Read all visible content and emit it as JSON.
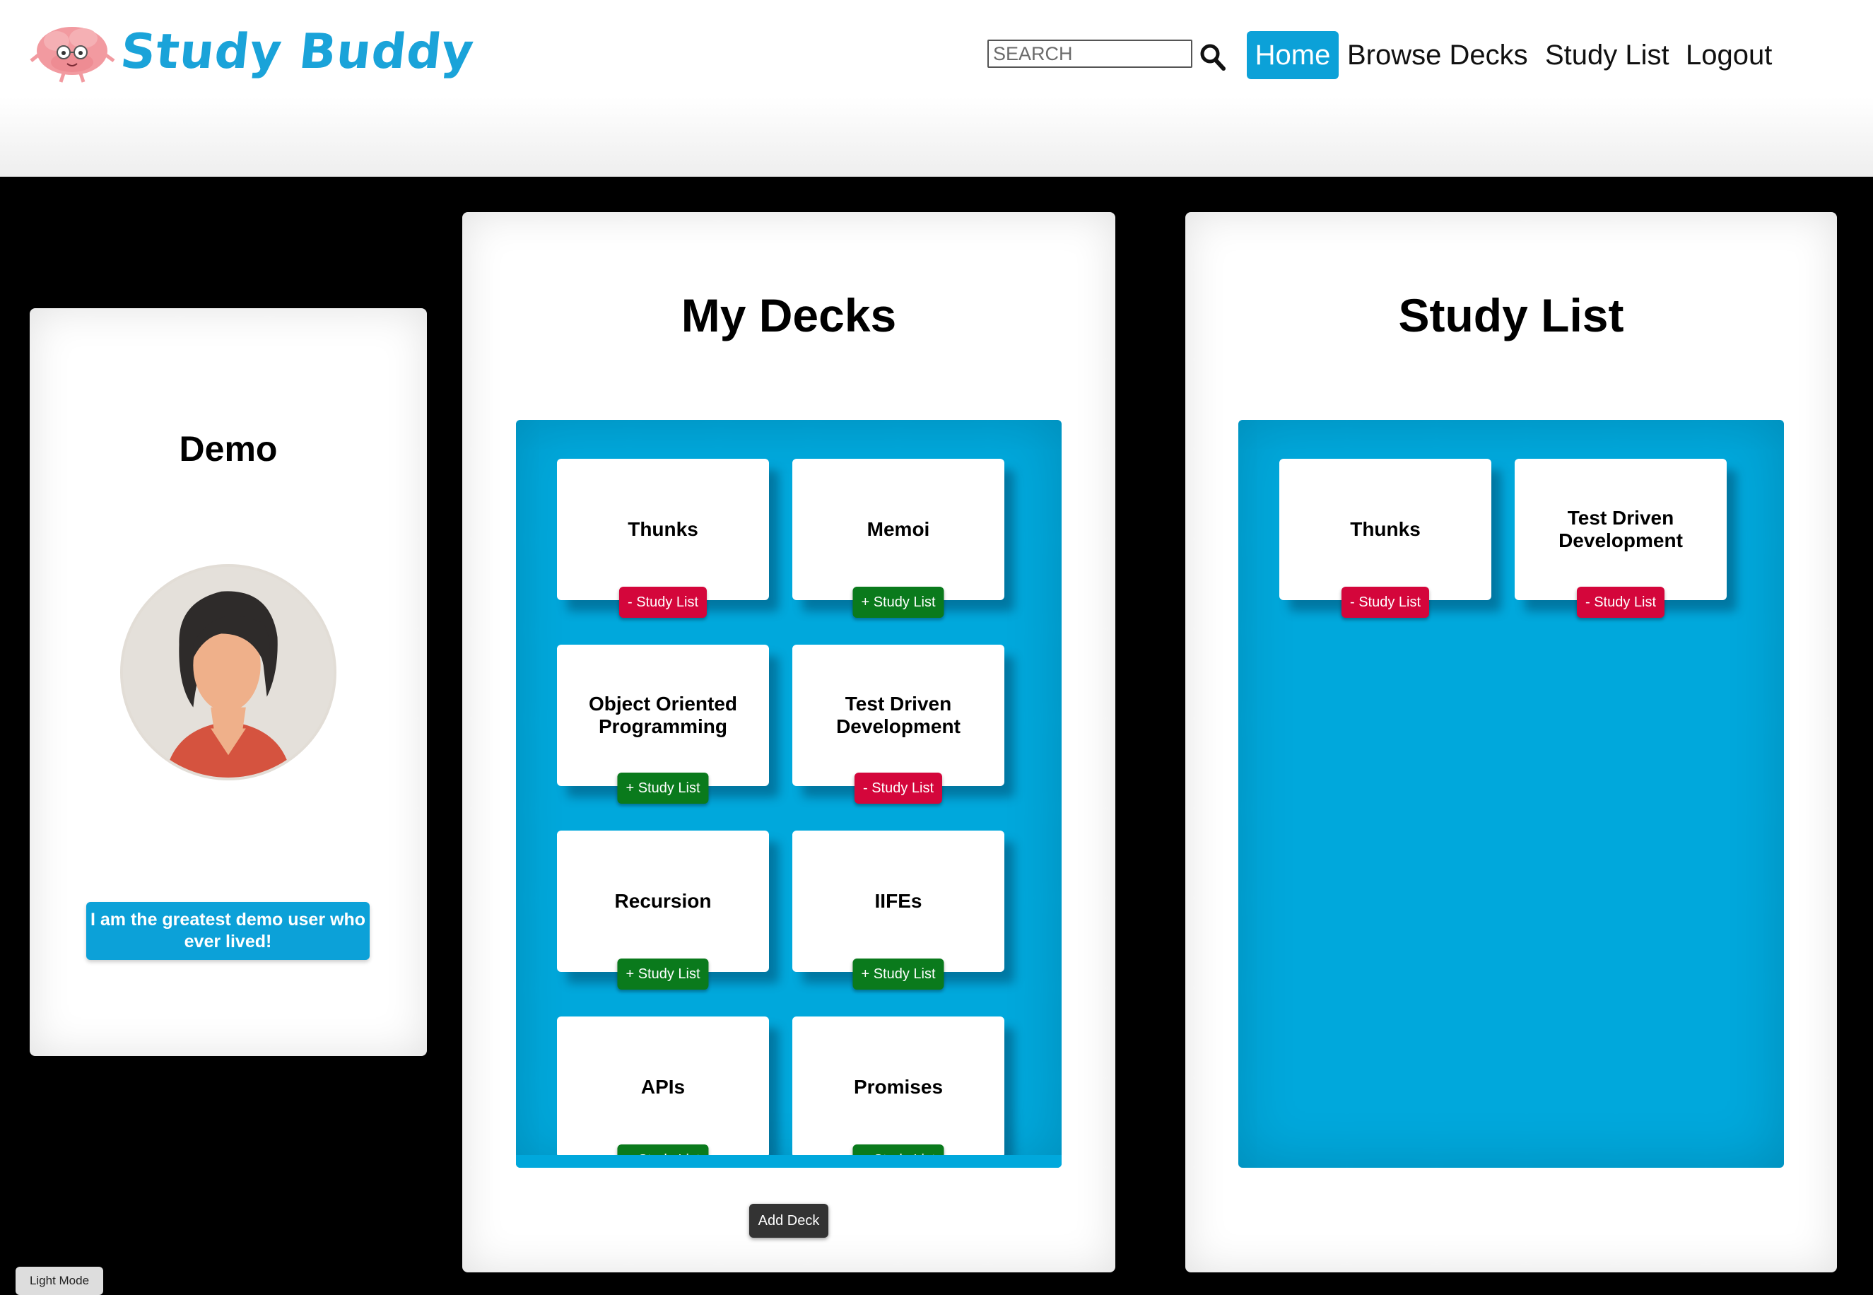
{
  "brand": {
    "name": "Study Buddy",
    "logo_icon": "brain-mascot-icon",
    "color": "#1aa3d9"
  },
  "search": {
    "placeholder": "SEARCH",
    "icon": "search-icon"
  },
  "nav": {
    "home": "Home",
    "browse": "Browse Decks",
    "study_list": "Study List",
    "logout": "Logout"
  },
  "profile": {
    "name": "Demo",
    "avatar_icon": "avatar-woman-icon",
    "bio": "I am the greatest demo user who ever lived!"
  },
  "my_decks": {
    "title": "My Decks",
    "cards": [
      {
        "title": "Thunks",
        "button": "- Study List",
        "state": "remove"
      },
      {
        "title": "Memoi",
        "button": "+ Study List",
        "state": "add"
      },
      {
        "title": "Object Oriented Programming",
        "button": "+ Study List",
        "state": "add"
      },
      {
        "title": "Test Driven Development",
        "button": "- Study List",
        "state": "remove"
      },
      {
        "title": "Recursion",
        "button": "+ Study List",
        "state": "add"
      },
      {
        "title": "IIFEs",
        "button": "+ Study List",
        "state": "add"
      },
      {
        "title": "APIs",
        "button": "+ Study List",
        "state": "add"
      },
      {
        "title": "Promises",
        "button": "+ Study List",
        "state": "add"
      }
    ],
    "add_deck": "Add Deck"
  },
  "study_list": {
    "title": "Study List",
    "cards": [
      {
        "title": "Thunks",
        "button": "- Study List",
        "state": "remove"
      },
      {
        "title": "Test Driven Development",
        "button": "- Study List",
        "state": "remove"
      }
    ]
  },
  "footer": {
    "light_mode": "Light Mode"
  },
  "colors": {
    "accent": "#0ca1d8",
    "remove": "#d4063b",
    "add": "#0a7a1c",
    "deck_bg": "#00a8dc"
  }
}
